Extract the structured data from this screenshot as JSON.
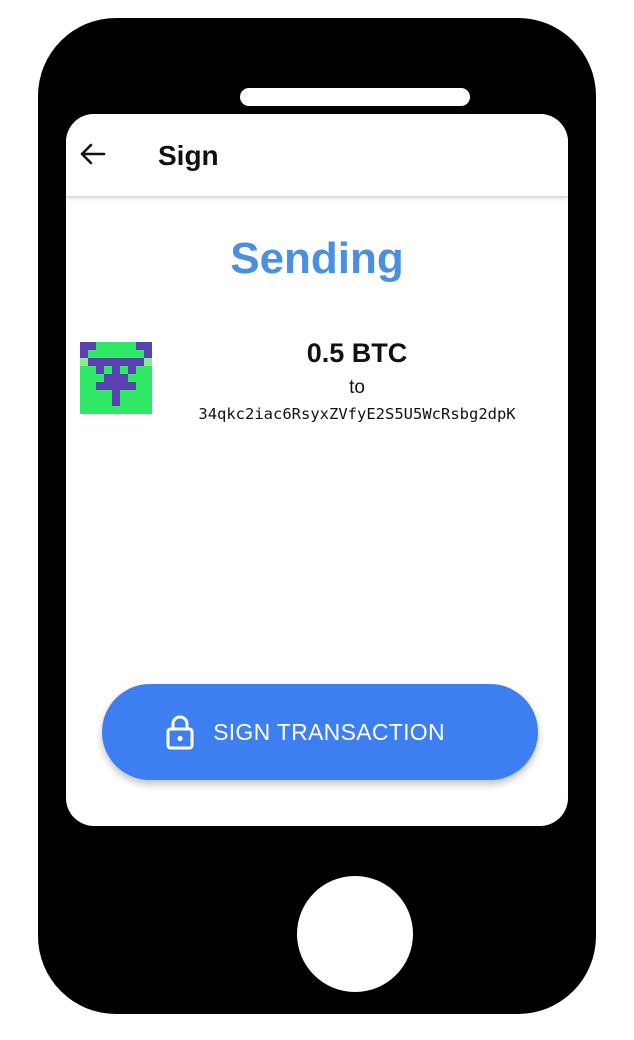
{
  "header": {
    "title": "Sign",
    "back_icon": "arrow-left-icon"
  },
  "heading": "Sending",
  "transaction": {
    "amount": "0.5 BTC",
    "to_label": "to",
    "address": "34qkc2iac6RsyxZVfyE2S5U5WcRsbg2dpK",
    "avatar_icon": "identicon"
  },
  "sign_button": {
    "label": "SIGN TRANSACTION",
    "icon": "lock-icon"
  },
  "colors": {
    "accent": "#4a8fe0",
    "button": "#3d7ff0",
    "identicon_primary": "#5a40b0",
    "identicon_secondary": "#2ee866",
    "identicon_light": "#8ee88e"
  }
}
